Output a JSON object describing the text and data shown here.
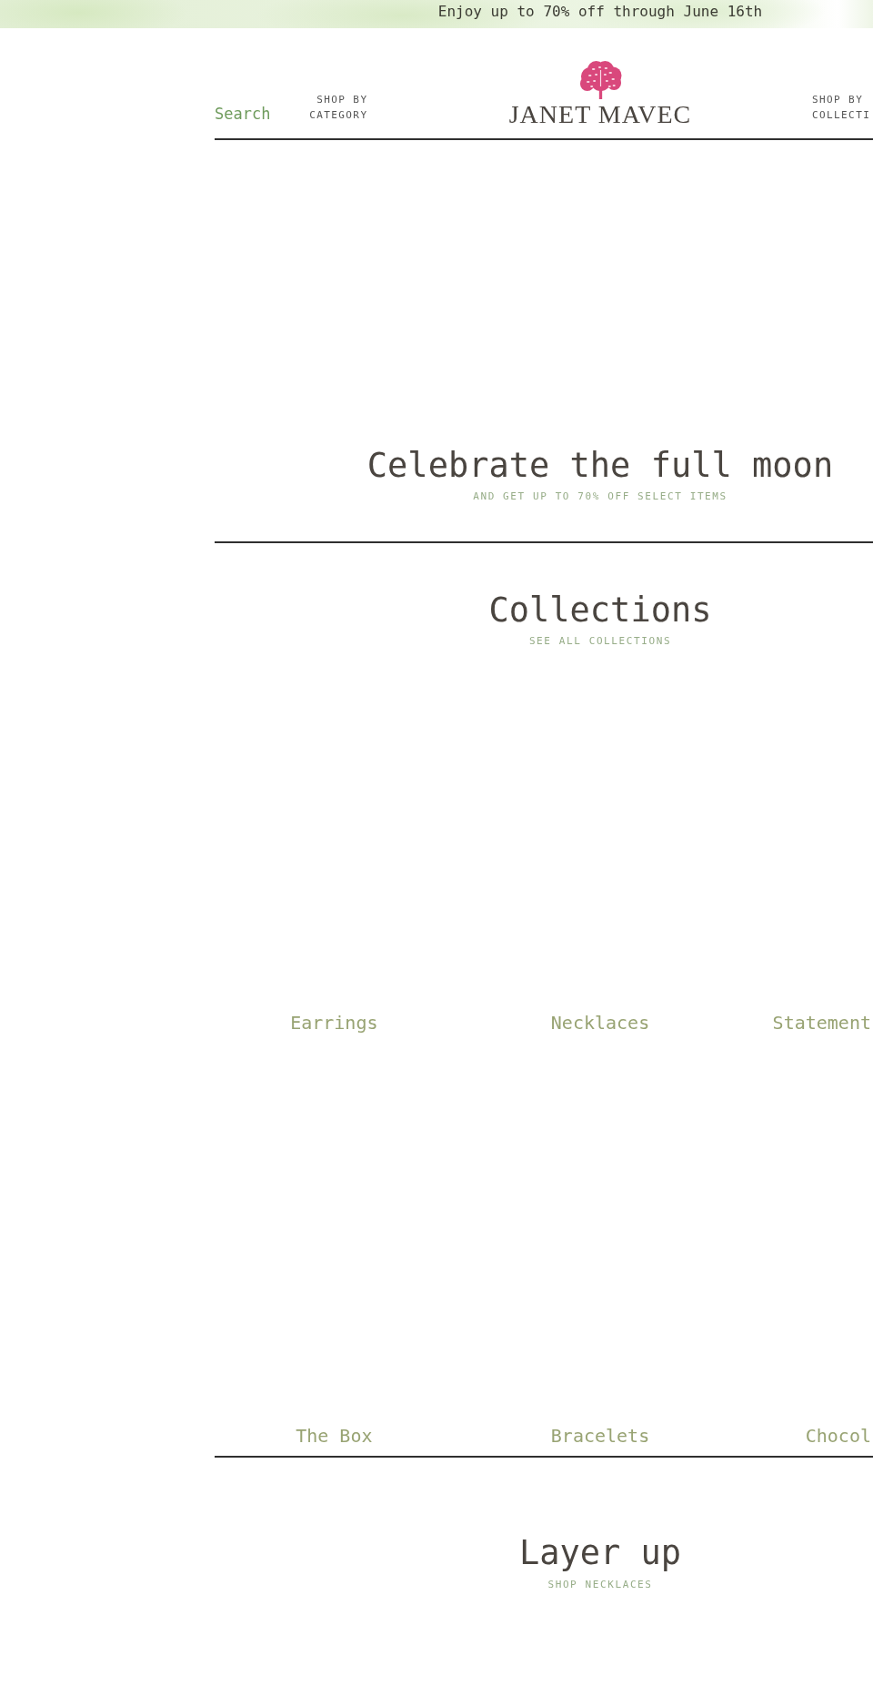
{
  "announcement_bar": {
    "text": "Enjoy up to 70% off through June 16th"
  },
  "header": {
    "search": {
      "label": "Search"
    },
    "nav": [
      {
        "label": "SHOP BY CATEGORY"
      },
      {
        "label": "SHOP BY COLLECTI"
      }
    ],
    "logo": {
      "text": "JANET MAVEC"
    }
  },
  "hero": {
    "title": "Celebrate the full moon",
    "link": "AND GET UP TO 70% OFF SELECT ITEMS"
  },
  "collections": {
    "title": "Collections",
    "link": "SEE ALL COLLECTIONS",
    "items": [
      {
        "label": "Earrings"
      },
      {
        "label": "Necklaces"
      },
      {
        "label": "Statement"
      },
      {
        "label": "The Box"
      },
      {
        "label": "Bracelets"
      },
      {
        "label": "Chocol"
      }
    ]
  },
  "feature": {
    "title": "Layer up",
    "link": "SHOP NECKLACES"
  }
}
